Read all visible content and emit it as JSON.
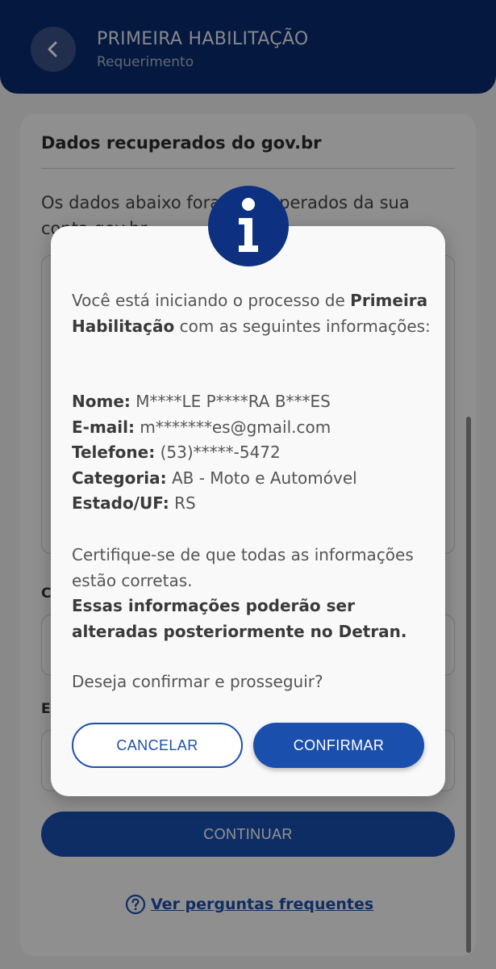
{
  "header": {
    "title": "PRIMEIRA HABILITAÇÃO",
    "subtitle": "Requerimento",
    "back_icon": "chevron-left-icon"
  },
  "card": {
    "heading": "Dados recuperados do gov.br",
    "intro": "Os dados abaixo foram recuperados da sua conta gov.br",
    "continue_label": "CONTINUAR",
    "faq_label": "Ver perguntas frequentes",
    "faq_icon": "question-circle-icon"
  },
  "dialog": {
    "icon": "info-icon",
    "intro_pre": "Você está iniciando o processo de ",
    "intro_bold": "Primeira Habilitação",
    "intro_post": " com as seguintes informações:",
    "fields": [
      {
        "label": "Nome:",
        "value": "M****LE P****RA B***ES"
      },
      {
        "label": "E-mail:",
        "value": "m*******es@gmail.com"
      },
      {
        "label": "Telefone:",
        "value": "(53)*****-5472"
      },
      {
        "label": "Categoria:",
        "value": "AB - Moto e Automóvel"
      },
      {
        "label": "Estado/UF:",
        "value": "RS"
      }
    ],
    "warning_text": "Certifique-se de que todas as informações estão corretas.",
    "warning_bold": "Essas informações poderão ser alteradas posteriormente no Detran.",
    "question": "Deseja confirmar e prosseguir?",
    "cancel_label": "CANCELAR",
    "confirm_label": "CONFIRMAR"
  },
  "colors": {
    "primary": "#1b4fae",
    "header_bg": "#0a2a6e",
    "badge_bg": "#0d3180"
  }
}
